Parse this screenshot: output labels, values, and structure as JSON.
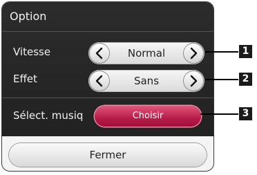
{
  "dialog": {
    "title": "Option",
    "rows": [
      {
        "label": "Vitesse",
        "value": "Normal"
      },
      {
        "label": "Effet",
        "value": "Sans"
      }
    ],
    "music": {
      "label": "Sélect. musiq",
      "button": "Choisir"
    },
    "close_label": "Fermer"
  },
  "callouts": [
    "1",
    "2",
    "3"
  ],
  "colors": {
    "dialog_bg": "#2c2c2c",
    "accent": "#b81c4a"
  },
  "icons": [
    "chevron-left-icon",
    "chevron-right-icon"
  ]
}
